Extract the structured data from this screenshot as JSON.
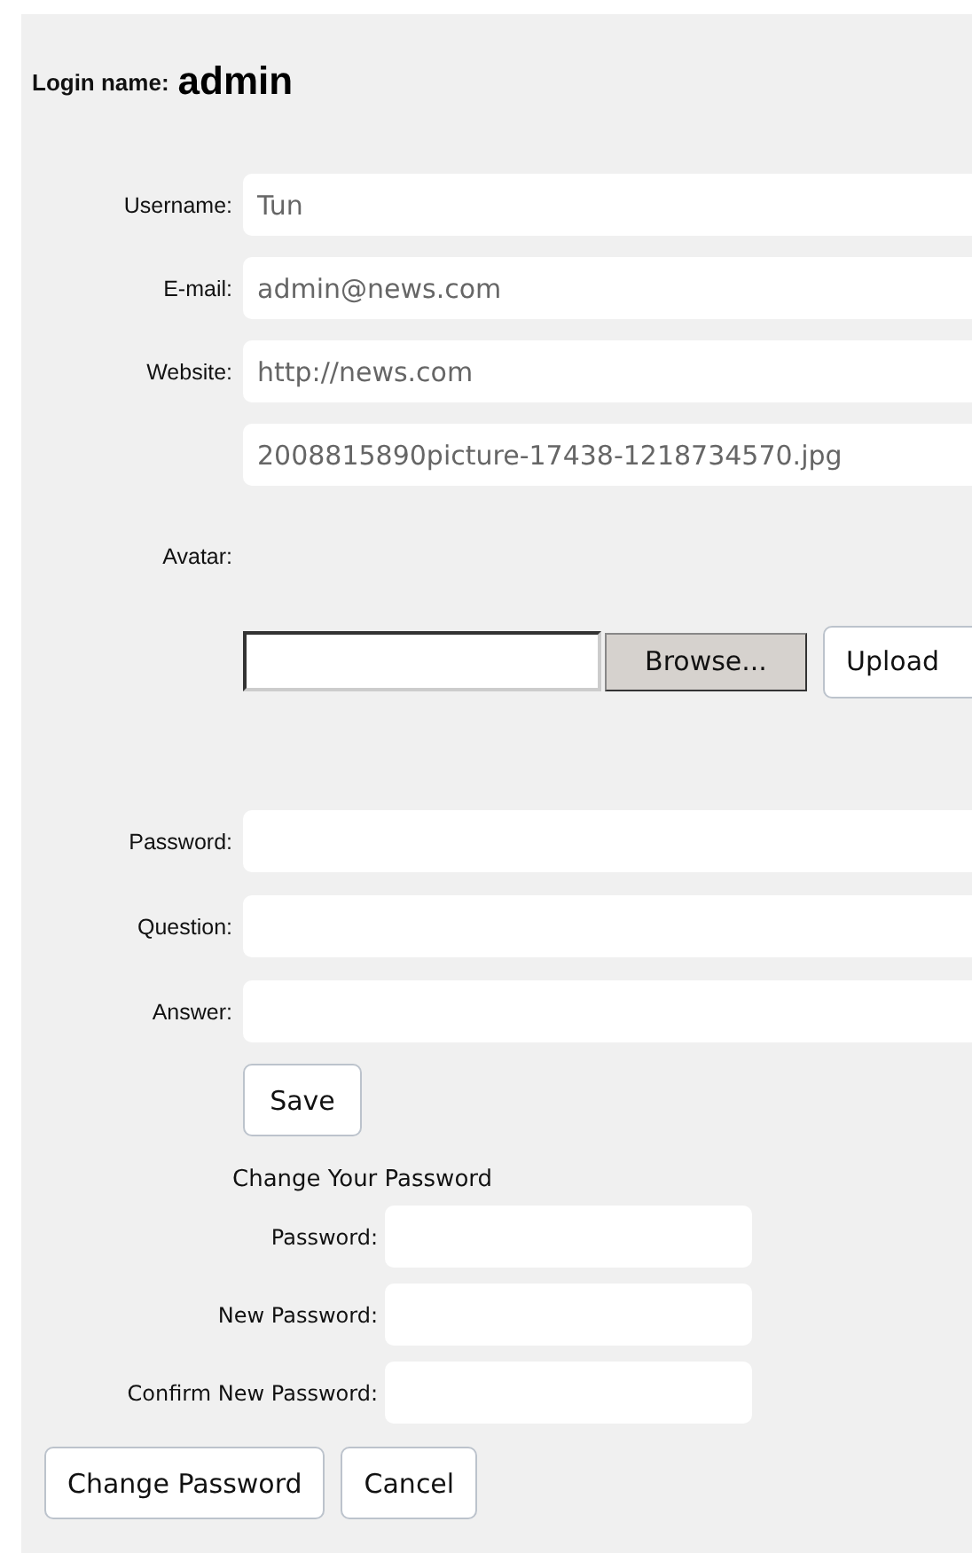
{
  "login": {
    "label": "Login name:",
    "value": "admin"
  },
  "profile_fields": [
    {
      "label": "Username:",
      "value": "Tun"
    },
    {
      "label": "E-mail:",
      "value": "admin@news.com"
    },
    {
      "label": "Website:",
      "value": "http://news.com"
    },
    {
      "value": "2008815890picture-17438-1218734570.jpg"
    }
  ],
  "avatar": {
    "label": "Avatar:",
    "browse_button": "Browse...",
    "upload_button": "Upload"
  },
  "account_fields": [
    {
      "label": "Password:"
    },
    {
      "label": "Question:"
    },
    {
      "label": "Answer:"
    }
  ],
  "save_button": "Save",
  "change_password": {
    "title": "Change Your Password",
    "fields": [
      {
        "label": "Password:"
      },
      {
        "label": "New Password:"
      },
      {
        "label": "Confirm New Password:"
      }
    ],
    "buttons": [
      "Change Password",
      "Cancel"
    ]
  }
}
